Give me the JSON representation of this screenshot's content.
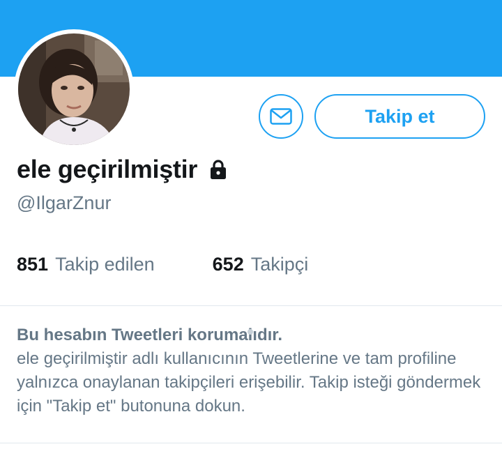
{
  "colors": {
    "accent": "#1da1f2",
    "text_primary": "#14171a",
    "text_secondary": "#657786",
    "divider": "#e1e8ed"
  },
  "profile": {
    "display_name": "ele geçirilmiştir",
    "handle": "@IlgarZnur",
    "avatar_icon": "profile-photo",
    "protected_icon": "lock-icon"
  },
  "actions": {
    "message_icon": "envelope-icon",
    "follow_label": "Takip et"
  },
  "stats": {
    "following_count": "851",
    "following_label": "Takip edilen",
    "followers_count": "652",
    "followers_label": "Takipçi"
  },
  "protected_notice": {
    "title": "Bu hesabın Tweetleri korumalıdır.",
    "body": "ele geçirilmiştir adlı kullanıcının Tweetlerine ve tam profiline yalnızca onaylanan takipçileri erişebilir. Takip isteği göndermek için \"Takip et\" butonuna dokun."
  }
}
